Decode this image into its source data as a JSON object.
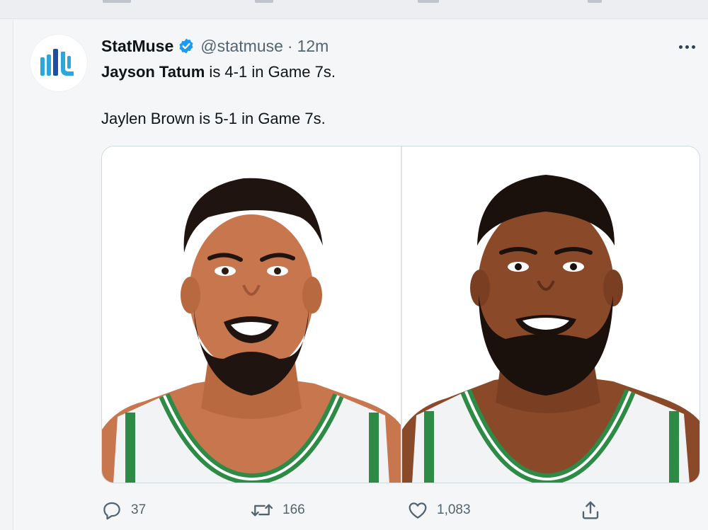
{
  "tweet": {
    "display_name": "StatMuse",
    "handle": "@statmuse",
    "separator": "·",
    "time": "12m",
    "text_line1_mention": "Jayson Tatum",
    "text_line1_rest": " is 4-1 in Game 7s.",
    "text_line2": "Jaylen Brown is 5-1 in Game 7s.",
    "media": [
      {
        "name": "jayson-tatum-illustration",
        "skin": "#c7764e",
        "beard": "#1f1410"
      },
      {
        "name": "jaylen-brown-illustration",
        "skin": "#8a4a2a",
        "beard": "#1a100c"
      }
    ]
  },
  "actions": {
    "replies": "37",
    "retweets": "166",
    "likes": "1,083"
  },
  "colors": {
    "brand_blue": "#1d9bf0",
    "avatar_bars": "#2aa7e0",
    "muted_text": "#536471",
    "jersey_green": "#2e8b45"
  }
}
